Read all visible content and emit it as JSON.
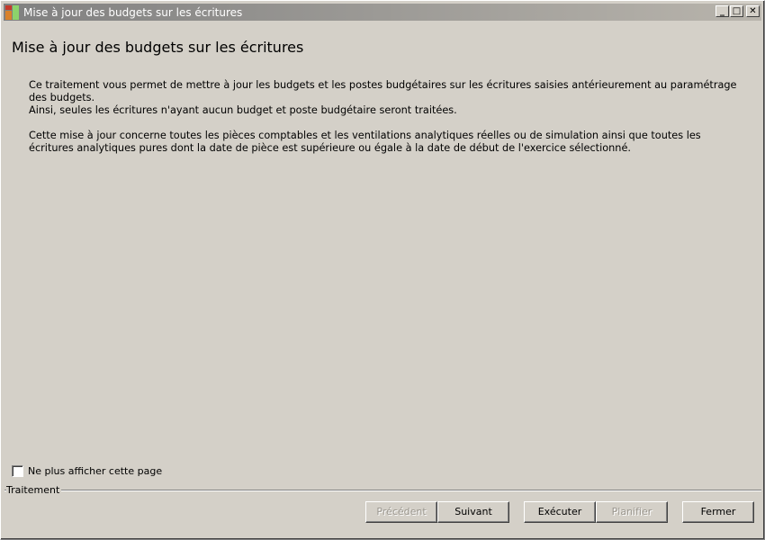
{
  "window": {
    "title": "Mise à jour des budgets sur les écritures",
    "controls": {
      "minimize": "_",
      "maximize": "□",
      "close": "✕"
    }
  },
  "main": {
    "page_title": "Mise à jour des budgets sur les écritures",
    "paragraphs": [
      "Ce traitement vous permet de mettre à jour les budgets et les postes budgétaires sur les écritures saisies antérieurement au paramétrage des budgets.",
      "Ainsi, seules les écritures n'ayant aucun budget et poste budgétaire seront traitées.",
      "Cette mise à jour concerne toutes les pièces comptables et les ventilations analytiques réelles ou de simulation ainsi que toutes les écritures analytiques pures dont la date de pièce est supérieure ou égale à la date de début de l'exercice sélectionné."
    ]
  },
  "footer": {
    "checkbox_label": "Ne plus afficher cette page",
    "group_label": "Traitement",
    "buttons": {
      "previous": "Précédent",
      "next": "Suivant",
      "execute": "Exécuter",
      "schedule": "Planifier",
      "close": "Fermer"
    }
  }
}
